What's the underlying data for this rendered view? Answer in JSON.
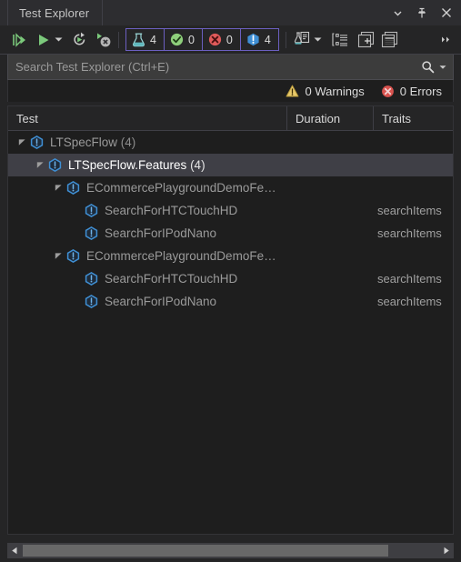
{
  "window": {
    "title": "Test Explorer",
    "buttons": [
      {
        "name": "window-dropdown",
        "icon": "chevron-down-icon"
      },
      {
        "name": "window-pin",
        "icon": "pin-icon"
      },
      {
        "name": "window-close",
        "icon": "close-icon"
      }
    ]
  },
  "toolbar": {
    "run_all_label": "Run All Tests",
    "run_label": "Run",
    "run_dropdown_label": "Run dropdown",
    "repeat_label": "Repeat Last Run",
    "stop_label": "Stop Test Run",
    "playlist_label": "Test Playlist",
    "playlist_dropdown_label": "Playlist dropdown",
    "group_by_label": "Group By",
    "expand_all_label": "Expand All",
    "collapse_all_label": "Collapse All",
    "overflow_label": "More options",
    "counters": [
      {
        "name": "total",
        "icon": "flask-icon",
        "value": "4"
      },
      {
        "name": "passed",
        "icon": "check-circle-icon",
        "value": "0"
      },
      {
        "name": "failed",
        "icon": "x-circle-icon",
        "value": "0"
      },
      {
        "name": "not-run",
        "icon": "info-hexagon-icon",
        "value": "4"
      }
    ]
  },
  "search": {
    "placeholder": "Search Test Explorer (Ctrl+E)",
    "value": "",
    "icon": "search-icon",
    "dropdown_icon": "chevron-down-icon"
  },
  "status": {
    "warnings": "0 Warnings",
    "errors": "0 Errors"
  },
  "grid": {
    "columns": [
      {
        "key": "test",
        "label": "Test"
      },
      {
        "key": "duration",
        "label": "Duration"
      },
      {
        "key": "traits",
        "label": "Traits"
      }
    ],
    "rows": [
      {
        "name": "row-ltspecflow",
        "label": "LTSpecFlow",
        "count": "(4)",
        "indent": 0,
        "twisty": "expanded",
        "icon": "not-run-icon",
        "duration": "",
        "traits": "",
        "selected": false
      },
      {
        "name": "row-ltspecflow-features",
        "label": "LTSpecFlow.Features",
        "count": "(4)",
        "indent": 1,
        "twisty": "expanded",
        "icon": "not-run-icon",
        "duration": "",
        "traits": "",
        "selected": true
      },
      {
        "name": "row-ecommerce-feature-1",
        "label": "ECommercePlaygroundDemoFe…",
        "count": "",
        "indent": 2,
        "twisty": "expanded",
        "icon": "not-run-icon",
        "duration": "",
        "traits": "",
        "selected": false
      },
      {
        "name": "row-searchforhtctouchhd-1",
        "label": "SearchForHTCTouchHD",
        "count": "",
        "indent": 3,
        "twisty": "none",
        "icon": "not-run-icon",
        "duration": "",
        "traits": "searchItems",
        "selected": false
      },
      {
        "name": "row-searchforipodnano-1",
        "label": "SearchForIPodNano",
        "count": "",
        "indent": 3,
        "twisty": "none",
        "icon": "not-run-icon",
        "duration": "",
        "traits": "searchItems",
        "selected": false
      },
      {
        "name": "row-ecommerce-feature-2",
        "label": "ECommercePlaygroundDemoFe…",
        "count": "",
        "indent": 2,
        "twisty": "expanded",
        "icon": "not-run-icon",
        "duration": "",
        "traits": "",
        "selected": false
      },
      {
        "name": "row-searchforhtctouchhd-2",
        "label": "SearchForHTCTouchHD",
        "count": "",
        "indent": 3,
        "twisty": "none",
        "icon": "not-run-icon",
        "duration": "",
        "traits": "searchItems",
        "selected": false
      },
      {
        "name": "row-searchforipodnano-2",
        "label": "SearchForIPodNano",
        "count": "",
        "indent": 3,
        "twisty": "none",
        "icon": "not-run-icon",
        "duration": "",
        "traits": "searchItems",
        "selected": false
      }
    ]
  },
  "scrollbar": {
    "left_arrow": "scroll-left-icon",
    "right_arrow": "scroll-right-icon",
    "thumb_width_pct": 88
  },
  "colors": {
    "accent_run": "#7bc97b",
    "accent_notrun": "#3f8fd4",
    "accent_pass": "#8ecf7b",
    "accent_fail": "#e05a5a",
    "counter_border": "#6b5fc0",
    "warning": "#e8c96a",
    "error": "#e05a5a",
    "selection": "#3f3f46"
  }
}
